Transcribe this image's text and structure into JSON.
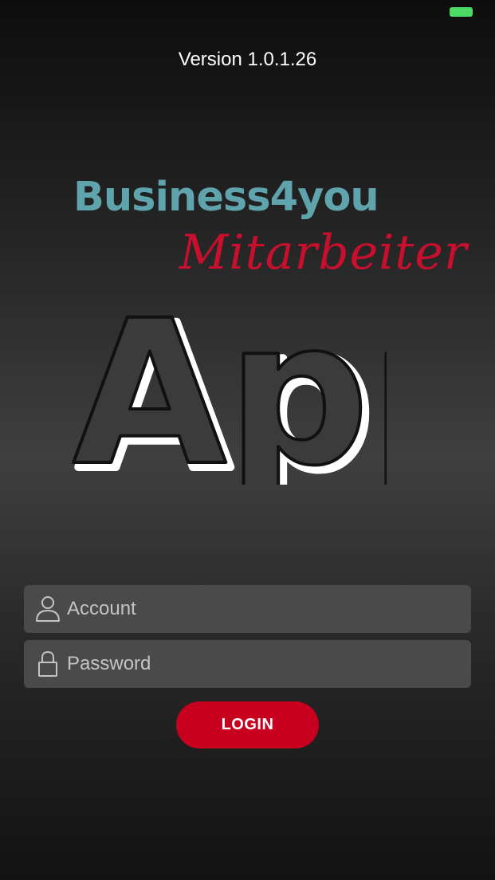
{
  "status_bar": {
    "carrier": "",
    "battery_color": "#4cd964"
  },
  "header": {
    "version": "Version 1.0.1.26"
  },
  "logo": {
    "brand": "Business4you",
    "subtitle": "Mitarbeiter",
    "app_word": "App",
    "brand_color": "#5fa3ad",
    "subtitle_color": "#c8102e"
  },
  "form": {
    "account": {
      "placeholder": "Account",
      "value": "",
      "icon": "user-icon"
    },
    "password": {
      "placeholder": "Password",
      "value": "",
      "icon": "lock-icon"
    },
    "login_label": "LOGIN",
    "accent_color": "#c8001f"
  }
}
